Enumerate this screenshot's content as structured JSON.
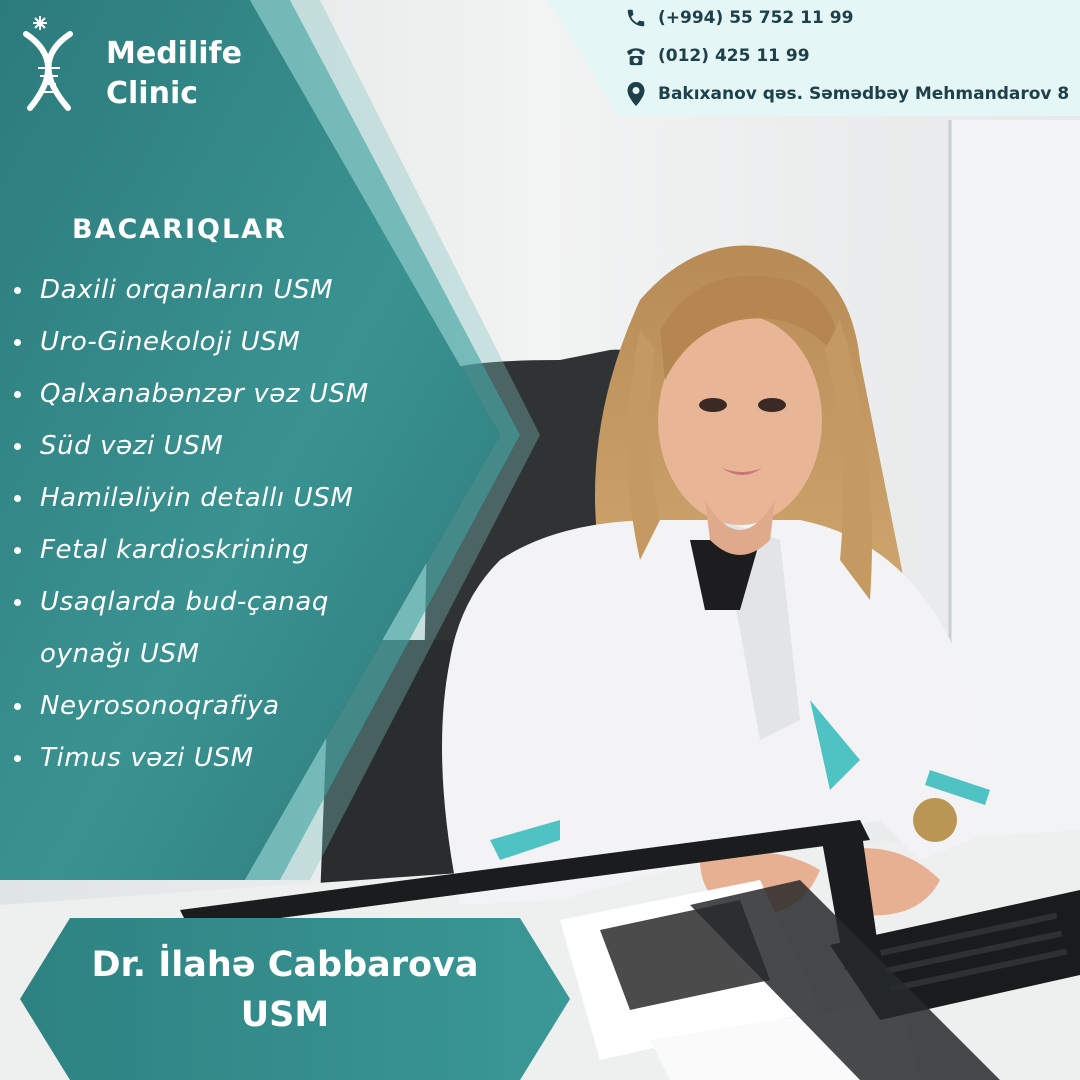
{
  "brand": {
    "name_line1": "Medilife",
    "name_line2": "Clinic",
    "logo_icon": "helix-logo-icon"
  },
  "contacts": {
    "mobile": "(+994) 55 752 11 99",
    "landline": "(012) 425 11 99",
    "address": "Bakıxanov qəs. Səmədbəy Mehmandarov 8",
    "icons": [
      "phone-handset-icon",
      "telephone-icon",
      "location-pin-icon"
    ]
  },
  "skills": {
    "title": "BACARIQLAR",
    "items": [
      "Daxili orqanların USM",
      "Uro-Ginekoloji USM",
      "Qalxanabənzər vəz USM",
      "Süd vəzi USM",
      "Hamiləliyin detallı USM",
      "Fetal kardioskrining",
      "Usaqlarda bud-çanaq",
      "oynağı USM",
      "Neyrosonoqrafiya",
      "Timus vəzi USM"
    ]
  },
  "doctor": {
    "name": "Dr. İlahə Cabbarova",
    "specialty": "USM"
  },
  "colors": {
    "teal_dark": "#2f7f80",
    "teal_mid": "#3f9a98",
    "teal_light": "#5cb7b3",
    "contact_bg": "#e4f6f7",
    "text_dark": "#1f4048"
  }
}
